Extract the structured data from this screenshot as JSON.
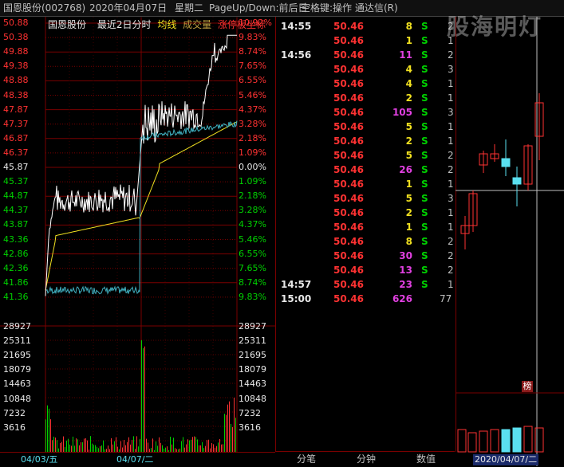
{
  "title_bar": {
    "stock": "国恩股份(002768)",
    "date": "2020年04月07日",
    "weekday": "星期二",
    "hint": "PageUp/Down:前后日",
    "hint2": "空格键:操作",
    "app": "通达信(R)"
  },
  "chart_header": {
    "stock_name": "国恩股份",
    "mode": "最近2日分时",
    "ma_label": "均线",
    "volume_label": "成交量",
    "extra_label": "涨停板坐标"
  },
  "price_axis": {
    "left": [
      "50.88",
      "50.38",
      "49.88",
      "49.38",
      "48.88",
      "48.38",
      "47.87",
      "47.37",
      "46.87",
      "46.37",
      "45.87",
      "45.37",
      "44.87",
      "44.37",
      "43.87",
      "43.36",
      "42.86",
      "42.36",
      "41.86",
      "41.36"
    ],
    "right": [
      "10.92%",
      "9.83%",
      "8.74%",
      "7.65%",
      "6.55%",
      "5.46%",
      "4.37%",
      "3.28%",
      "2.18%",
      "1.09%",
      "0.00%",
      "1.09%",
      "2.18%",
      "3.28%",
      "4.37%",
      "5.46%",
      "6.55%",
      "7.65%",
      "8.74%",
      "9.83%"
    ]
  },
  "volume_axis": [
    "28927",
    "25311",
    "21695",
    "18079",
    "14463",
    "10848",
    "7232",
    "3616"
  ],
  "date_labels": {
    "day1": "04/03/五",
    "day2": "04/07/二"
  },
  "ticks": [
    {
      "time": "14:55",
      "price": "50.46",
      "vol": "8",
      "side": "S",
      "n": "2"
    },
    {
      "time": "",
      "price": "50.46",
      "vol": "1",
      "side": "S",
      "n": "1"
    },
    {
      "time": "14:56",
      "price": "50.46",
      "vol": "11",
      "side": "S",
      "n": "2"
    },
    {
      "time": "",
      "price": "50.46",
      "vol": "4",
      "side": "S",
      "n": "3"
    },
    {
      "time": "",
      "price": "50.46",
      "vol": "4",
      "side": "S",
      "n": "1"
    },
    {
      "time": "",
      "price": "50.46",
      "vol": "2",
      "side": "S",
      "n": "1"
    },
    {
      "time": "",
      "price": "50.46",
      "vol": "105",
      "side": "S",
      "n": "3"
    },
    {
      "time": "",
      "price": "50.46",
      "vol": "5",
      "side": "S",
      "n": "1"
    },
    {
      "time": "",
      "price": "50.46",
      "vol": "2",
      "side": "S",
      "n": "1"
    },
    {
      "time": "",
      "price": "50.46",
      "vol": "5",
      "side": "S",
      "n": "2"
    },
    {
      "time": "",
      "price": "50.46",
      "vol": "26",
      "side": "S",
      "n": "2"
    },
    {
      "time": "",
      "price": "50.46",
      "vol": "1",
      "side": "S",
      "n": "1"
    },
    {
      "time": "",
      "price": "50.46",
      "vol": "5",
      "side": "S",
      "n": "3"
    },
    {
      "time": "",
      "price": "50.46",
      "vol": "2",
      "side": "S",
      "n": "1"
    },
    {
      "time": "",
      "price": "50.46",
      "vol": "1",
      "side": "S",
      "n": "1"
    },
    {
      "time": "",
      "price": "50.46",
      "vol": "8",
      "side": "S",
      "n": "2"
    },
    {
      "time": "",
      "price": "50.46",
      "vol": "30",
      "side": "S",
      "n": "2"
    },
    {
      "time": "",
      "price": "50.46",
      "vol": "13",
      "side": "S",
      "n": "2"
    },
    {
      "time": "14:57",
      "price": "50.46",
      "vol": "23",
      "side": "S",
      "n": "1"
    },
    {
      "time": "15:00",
      "price": "50.46",
      "vol": "626",
      "side": "",
      "n": "77"
    }
  ],
  "bottom_tabs": [
    "分笔",
    "分钟",
    "数值"
  ],
  "kline_date": "2020/04/07/二",
  "kline_badge": "榜",
  "watermark": "股海明灯",
  "colors": {
    "up": "#ff3232",
    "down": "#5ae0f0",
    "price_line": "#ffffff",
    "avg_line": "#f0e020",
    "grid": "#7a0000"
  }
}
